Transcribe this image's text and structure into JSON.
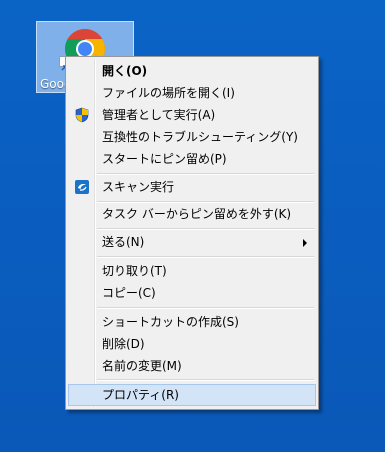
{
  "desktop": {
    "icon_label": "Google Chrome"
  },
  "menu": {
    "items": [
      {
        "label": "開く(O)",
        "bold": true,
        "icon": ""
      },
      {
        "label": "ファイルの場所を開く(I)",
        "icon": ""
      },
      {
        "label": "管理者として実行(A)",
        "icon": "uac-shield-icon"
      },
      {
        "label": "互換性のトラブルシューティング(Y)",
        "icon": ""
      },
      {
        "label": "スタートにピン留め(P)",
        "icon": ""
      },
      {
        "label": "スキャン実行",
        "icon": "antivirus-scan-icon"
      },
      {
        "label": "タスク バーからピン留めを外す(K)",
        "icon": ""
      },
      {
        "label": "送る(N)",
        "icon": "",
        "submenu": true
      },
      {
        "label": "切り取り(T)",
        "icon": ""
      },
      {
        "label": "コピー(C)",
        "icon": ""
      },
      {
        "label": "ショートカットの作成(S)",
        "icon": ""
      },
      {
        "label": "削除(D)",
        "icon": ""
      },
      {
        "label": "名前の変更(M)",
        "icon": ""
      },
      {
        "label": "プロパティ(R)",
        "icon": "",
        "highlighted": true
      }
    ]
  },
  "colors": {
    "desktop_background": "#0a5ec0",
    "menu_background": "#f0f0f0",
    "highlight_background": "#d4e4f7",
    "highlight_border": "#a8c7ec"
  }
}
